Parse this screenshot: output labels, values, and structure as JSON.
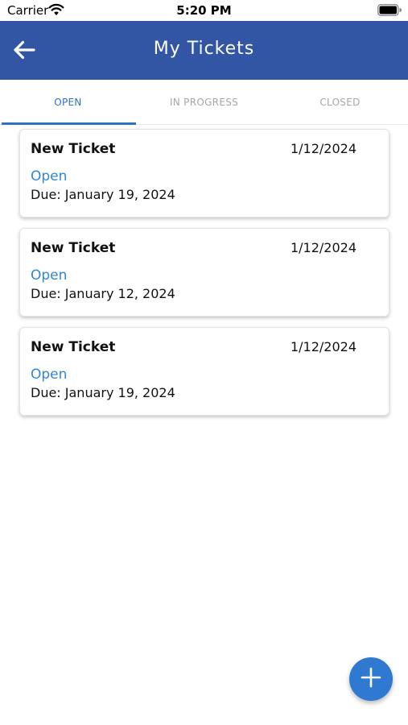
{
  "status_bar": {
    "carrier": "Carrier",
    "time": "5:20 PM",
    "wifi_icon": "wifi-icon",
    "battery_icon": "battery-icon"
  },
  "app_bar": {
    "title": "My Tickets",
    "back_icon": "arrow-left-icon",
    "background_color": "#3256a3"
  },
  "tabs": [
    {
      "label": "OPEN",
      "active": true
    },
    {
      "label": "IN PROGRESS",
      "active": false
    },
    {
      "label": "CLOSED",
      "active": false
    }
  ],
  "accent_color": "#2f71c4",
  "tickets": [
    {
      "title": "New Ticket",
      "date": "1/12/2024",
      "status": "Open",
      "due": "Due: January 19, 2024"
    },
    {
      "title": "New Ticket",
      "date": "1/12/2024",
      "status": "Open",
      "due": "Due: January 12, 2024"
    },
    {
      "title": "New Ticket",
      "date": "1/12/2024",
      "status": "Open",
      "due": "Due: January 19, 2024"
    }
  ],
  "fab": {
    "icon": "plus-icon",
    "color": "#2f79d0"
  }
}
